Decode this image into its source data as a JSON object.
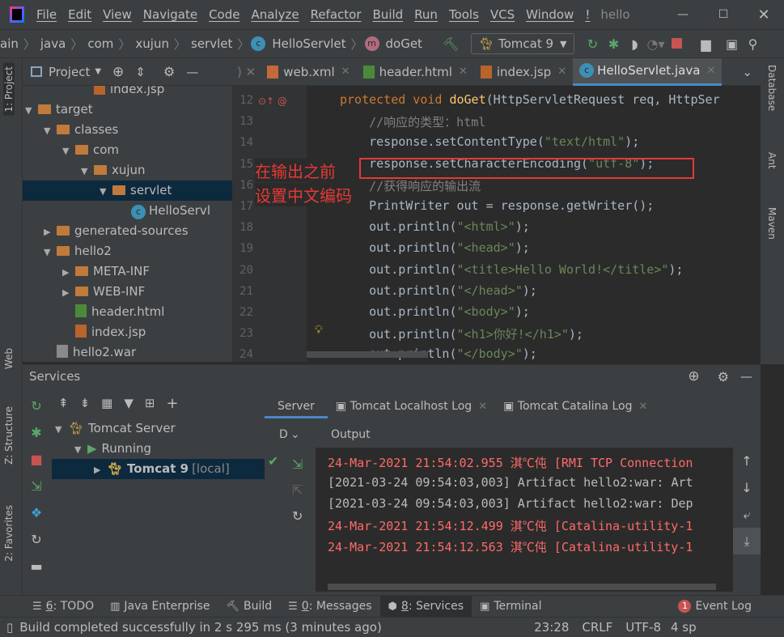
{
  "menu": {
    "items": [
      "File",
      "Edit",
      "View",
      "Navigate",
      "Code",
      "Analyze",
      "Refactor",
      "Build",
      "Run",
      "Tools",
      "VCS",
      "Window",
      "!"
    ],
    "project_title": "hello"
  },
  "nav": {
    "breadcrumbs": [
      "ain",
      "java",
      "com",
      "xujun",
      "servlet",
      "HelloServlet",
      "doGet"
    ],
    "run_config": "Tomcat 9"
  },
  "left_strip": {
    "project": "1: Project",
    "web": "Web",
    "structure": "Z: Structure",
    "favorites": "2: Favorites"
  },
  "right_strip": {
    "database": "Database",
    "ant": "Ant",
    "maven": "Maven"
  },
  "project": {
    "title": "Project",
    "tree": [
      {
        "label": "index.jsp",
        "type": "jsp"
      },
      {
        "label": "target",
        "type": "folder",
        "expanded": true
      },
      {
        "label": "classes",
        "type": "folder",
        "expanded": true
      },
      {
        "label": "com",
        "type": "folder",
        "expanded": true
      },
      {
        "label": "xujun",
        "type": "folder",
        "expanded": true
      },
      {
        "label": "servlet",
        "type": "folder",
        "expanded": true,
        "selected": true
      },
      {
        "label": "HelloServl",
        "type": "class"
      },
      {
        "label": "generated-sources",
        "type": "folder",
        "expanded": false
      },
      {
        "label": "hello2",
        "type": "folder",
        "expanded": true
      },
      {
        "label": "META-INF",
        "type": "folder",
        "expanded": false
      },
      {
        "label": "WEB-INF",
        "type": "folder",
        "expanded": false
      },
      {
        "label": "header.html",
        "type": "html"
      },
      {
        "label": "index.jsp",
        "type": "jsp"
      },
      {
        "label": "hello2.war",
        "type": "war"
      }
    ]
  },
  "editor": {
    "tabs": [
      {
        "label": "web.xml"
      },
      {
        "label": "header.html"
      },
      {
        "label": "index.jsp"
      },
      {
        "label": "HelloServlet.java",
        "active": true
      }
    ],
    "lines": [
      {
        "n": "12",
        "parts": [
          [
            "kw",
            "protected void "
          ],
          [
            "fn",
            "doGet"
          ],
          [
            "t",
            "(HttpServletRequest req, HttpSer"
          ]
        ]
      },
      {
        "n": "13",
        "parts": [
          [
            "cm",
            "    //响应的类型：html"
          ]
        ]
      },
      {
        "n": "14",
        "parts": [
          [
            "t",
            "    response.setContentType("
          ],
          [
            "str",
            "\"text/html\""
          ],
          [
            "t",
            ");"
          ]
        ]
      },
      {
        "n": "15",
        "parts": [
          [
            "t",
            "    response.setCharacterEncoding("
          ],
          [
            "str",
            "\"utf-8\""
          ],
          [
            "t",
            ");"
          ]
        ]
      },
      {
        "n": "16",
        "parts": [
          [
            "cm",
            "    //获得响应的输出流"
          ]
        ]
      },
      {
        "n": "17",
        "parts": [
          [
            "t",
            "    PrintWriter out = response.getWriter();"
          ]
        ]
      },
      {
        "n": "18",
        "parts": [
          [
            "t",
            "    out.println("
          ],
          [
            "str",
            "\"<html>\""
          ],
          [
            "t",
            ");"
          ]
        ]
      },
      {
        "n": "19",
        "parts": [
          [
            "t",
            "    out.println("
          ],
          [
            "str",
            "\"<head>\""
          ],
          [
            "t",
            ");"
          ]
        ]
      },
      {
        "n": "20",
        "parts": [
          [
            "t",
            "    out.println("
          ],
          [
            "str",
            "\"<title>Hello World!</title>\""
          ],
          [
            "t",
            ");"
          ]
        ]
      },
      {
        "n": "21",
        "parts": [
          [
            "t",
            "    out.println("
          ],
          [
            "str",
            "\"</head>\""
          ],
          [
            "t",
            ");"
          ]
        ]
      },
      {
        "n": "22",
        "parts": [
          [
            "t",
            "    out.println("
          ],
          [
            "str",
            "\"<body>\""
          ],
          [
            "t",
            ");"
          ]
        ]
      },
      {
        "n": "23",
        "parts": [
          [
            "t",
            "    out.println("
          ],
          [
            "str",
            "\"<h1>你好!</h1>\""
          ],
          [
            "t",
            ");"
          ]
        ]
      },
      {
        "n": "24",
        "parts": [
          [
            "t",
            "    out.println("
          ],
          [
            "str",
            "\"</body>\""
          ],
          [
            "t",
            ");"
          ]
        ]
      }
    ],
    "annotation": {
      "line1": "在输出之前",
      "line2": "设置中文编码",
      "color": "#e53935"
    }
  },
  "services": {
    "title": "Services",
    "tree": [
      {
        "label": "Tomcat Server"
      },
      {
        "label": "Running"
      },
      {
        "label": "Tomcat 9",
        "suffix": "[local]"
      }
    ],
    "tabs": [
      "Server",
      "Tomcat Localhost Log",
      "Tomcat Catalina Log"
    ],
    "output_label": "Output",
    "col_label": "D",
    "log": [
      {
        "text": "24-Mar-2021 21:54:02.955 淇℃伅 [RMI TCP Connection",
        "level": "red"
      },
      {
        "text": "[2021-03-24 09:54:03,003] Artifact hello2:war: Art",
        "level": "gray"
      },
      {
        "text": "[2021-03-24 09:54:03,003] Artifact hello2:war: Dep",
        "level": "gray"
      },
      {
        "text": "24-Mar-2021 21:54:12.499 淇℃伅 [Catalina-utility-1",
        "level": "red"
      },
      {
        "text": "24-Mar-2021 21:54:12.563 淇℃伅 [Catalina-utility-1",
        "level": "red"
      }
    ]
  },
  "bottom_tools": [
    {
      "key": "6",
      "label": ": TODO"
    },
    {
      "key": "",
      "label": "Java Enterprise"
    },
    {
      "key": "",
      "label": "Build"
    },
    {
      "key": "0",
      "label": ": Messages"
    },
    {
      "key": "8",
      "label": ": Services",
      "active": true
    },
    {
      "key": "",
      "label": "Terminal"
    }
  ],
  "event_log": {
    "count": "1",
    "label": "Event Log"
  },
  "status": {
    "message": "Build completed successfully in 2 s 295 ms (3 minutes ago)",
    "position": "23:28",
    "line_sep": "CRLF",
    "encoding": "UTF-8",
    "indent": "4 sp"
  }
}
